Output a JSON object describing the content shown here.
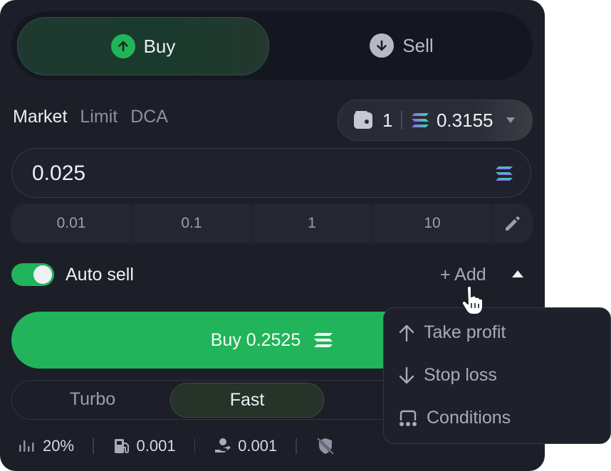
{
  "side": {
    "buy_label": "Buy",
    "sell_label": "Sell"
  },
  "order_types": [
    "Market",
    "Limit",
    "DCA"
  ],
  "wallet": {
    "count": "1",
    "balance": "0.3155"
  },
  "amount": {
    "value": "0.025"
  },
  "presets": [
    "0.01",
    "0.1",
    "1",
    "10"
  ],
  "auto_sell": {
    "label": "Auto sell",
    "enabled": true,
    "add_label": "+ Add"
  },
  "buy_button": {
    "label": "Buy 0.2525"
  },
  "speed": {
    "turbo_label": "Turbo",
    "fast_label": "Fast",
    "selected": "Fast"
  },
  "stats": {
    "slippage": "20%",
    "priority_fee": "0.001",
    "tip": "0.001"
  },
  "dropdown": {
    "items": [
      {
        "label": "Take profit",
        "icon": "arrow-up-icon"
      },
      {
        "label": "Stop loss",
        "icon": "arrow-down-icon"
      },
      {
        "label": "Conditions",
        "icon": "conditions-icon"
      }
    ]
  },
  "colors": {
    "accent_green": "#22b45a",
    "panel_bg": "#1c1f28",
    "text_primary": "#eef0f4",
    "text_muted": "#8b8fa4"
  }
}
